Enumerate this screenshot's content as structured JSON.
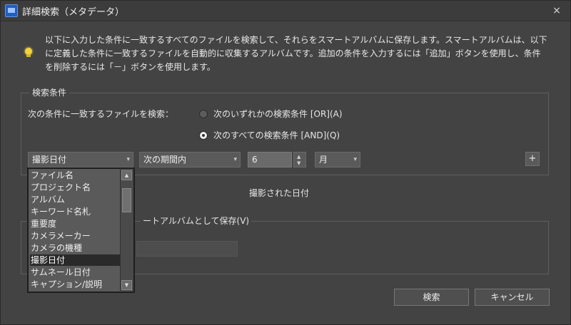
{
  "window": {
    "title": "詳細検索（メタデータ）",
    "close": "×"
  },
  "description": "以下に入力した条件に一致するすべてのファイルを検索して、それらをスマートアルバムに保存します。スマートアルバムは、以下に定義した条件に一致するファイルを自動的に収集するアルバムです。追加の条件を入力するには「追加」ボタンを使用し、条件を削除するには「－」ボタンを使用します。",
  "criteria": {
    "group_label": "検索条件",
    "match_label": "次の条件に一致するファイルを検索：",
    "option_or": "次のいずれかの検索条件 [OR](A)",
    "option_and": "次のすべての検索条件 [AND](Q)",
    "selected_option": "and",
    "field_value": "撮影日付",
    "operator_value": "次の期間内",
    "number_value": "6",
    "unit_value": "月",
    "add_button": "+",
    "date_caption": "撮影された日付"
  },
  "save": {
    "group_label": "ートアルバムとして保存(V)"
  },
  "dropdown": {
    "items": [
      "ファイル名",
      "プロジェクト名",
      "アルバム",
      "キーワード名札",
      "重要度",
      "カメラメーカー",
      "カメラの機種",
      "撮影日付",
      "サムネール日付",
      "キャプション/説明"
    ],
    "selected_index": 7
  },
  "buttons": {
    "search": "検索",
    "cancel": "キャンセル"
  },
  "icons": {
    "app": "app-icon",
    "info": "lightbulb-icon",
    "scroll_up": "▲",
    "scroll_down": "▼",
    "combo_arrow": "▾"
  }
}
